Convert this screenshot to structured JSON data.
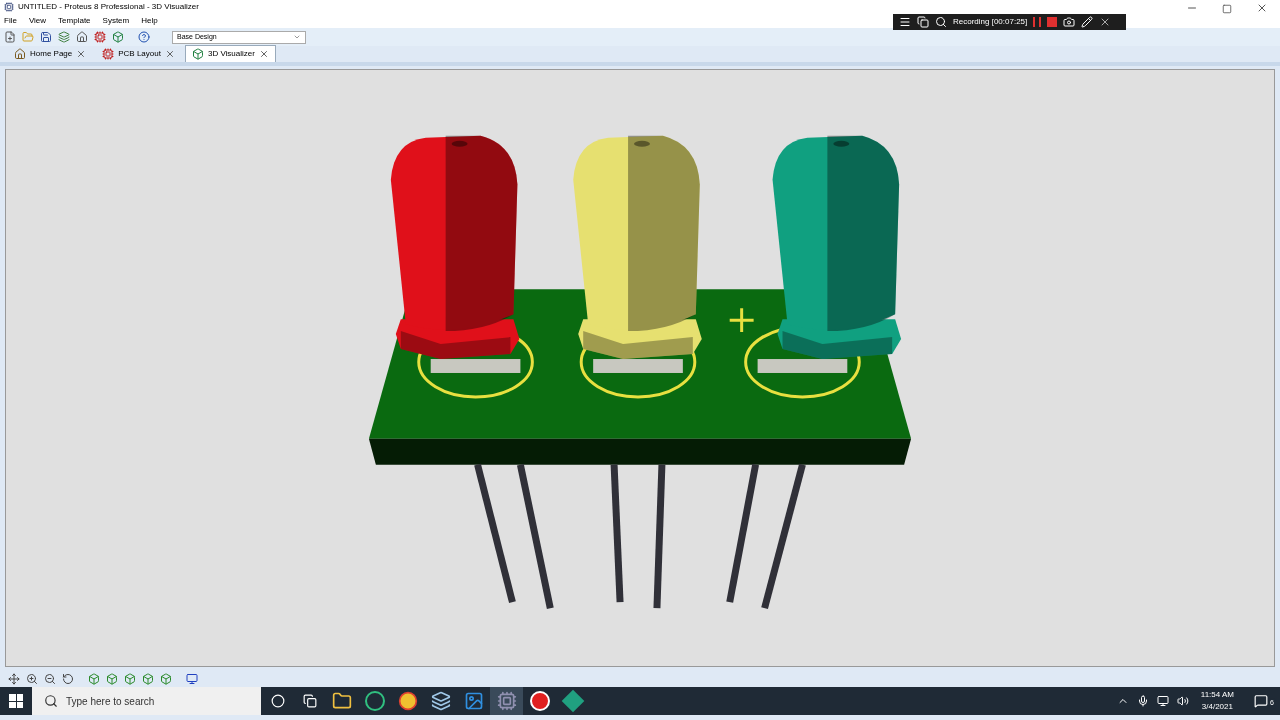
{
  "window": {
    "title": "UNTITLED - Proteus 8 Professional - 3D Visualizer"
  },
  "menu": [
    "File",
    "View",
    "Template",
    "System",
    "Help"
  ],
  "toolbar": {
    "variant": "Base Design"
  },
  "tabs": [
    {
      "label": "Home Page",
      "kind": "home",
      "selected": false
    },
    {
      "label": "PCB Layout",
      "kind": "pcb",
      "selected": false
    },
    {
      "label": "3D Visualizer",
      "kind": "visualizer",
      "selected": true
    }
  ],
  "recording": {
    "label": "Recording [00:07:25]"
  },
  "scene": {
    "leds": [
      {
        "color": "#e0101a"
      },
      {
        "color": "#e6e070"
      },
      {
        "color": "#10a080"
      }
    ]
  },
  "taskbar": {
    "search": {
      "placeholder": "Type here to search"
    },
    "apps": [
      {
        "kind": "folder",
        "selected": false
      },
      {
        "kind": "u",
        "selected": false
      },
      {
        "kind": "browser",
        "selected": false
      },
      {
        "kind": "notes",
        "selected": false
      },
      {
        "kind": "photos",
        "selected": false
      },
      {
        "kind": "proteus",
        "selected": true
      },
      {
        "kind": "record",
        "selected": false
      },
      {
        "kind": "app",
        "selected": false
      }
    ],
    "time": "11:54 AM",
    "date": "3/4/2021",
    "notifications": "6"
  }
}
